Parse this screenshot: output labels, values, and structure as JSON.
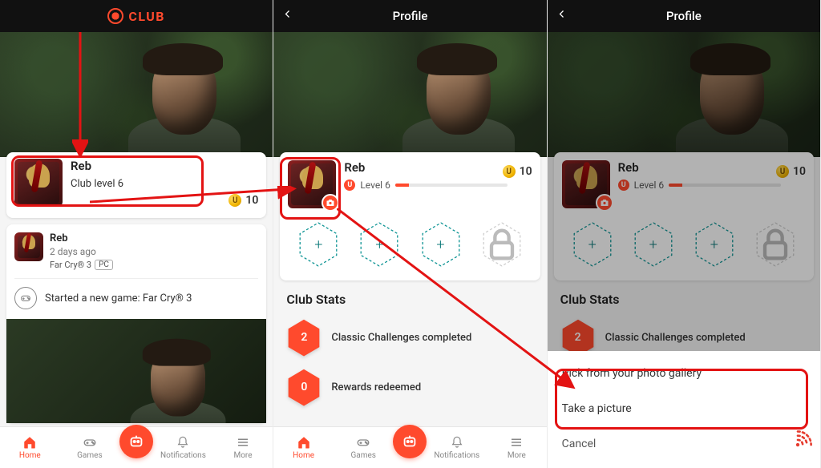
{
  "brand": {
    "name": "CLUB"
  },
  "header": {
    "profile_title": "Profile"
  },
  "coins": {
    "value": "10"
  },
  "user": {
    "name": "Reb",
    "club_level_line": "Club level 6",
    "level_label": "Level 6"
  },
  "activity": {
    "author": "Reb",
    "time": "2 days ago",
    "game": "Far Cry® 3",
    "platform": "PC",
    "line": "Started a new game: Far Cry® 3"
  },
  "hex_slots": {
    "plus": "+",
    "lock": "🔒"
  },
  "club_stats": {
    "title": "Club Stats",
    "rows": [
      {
        "value": "2",
        "label": "Classic Challenges completed"
      },
      {
        "value": "0",
        "label": "Rewards redeemed"
      }
    ]
  },
  "sheet": {
    "option_gallery": "Pick from your photo gallery",
    "option_camera": "Take a picture",
    "cancel": "Cancel"
  },
  "tabs": {
    "home": "Home",
    "games": "Games",
    "notifications": "Notifications",
    "more": "More"
  }
}
